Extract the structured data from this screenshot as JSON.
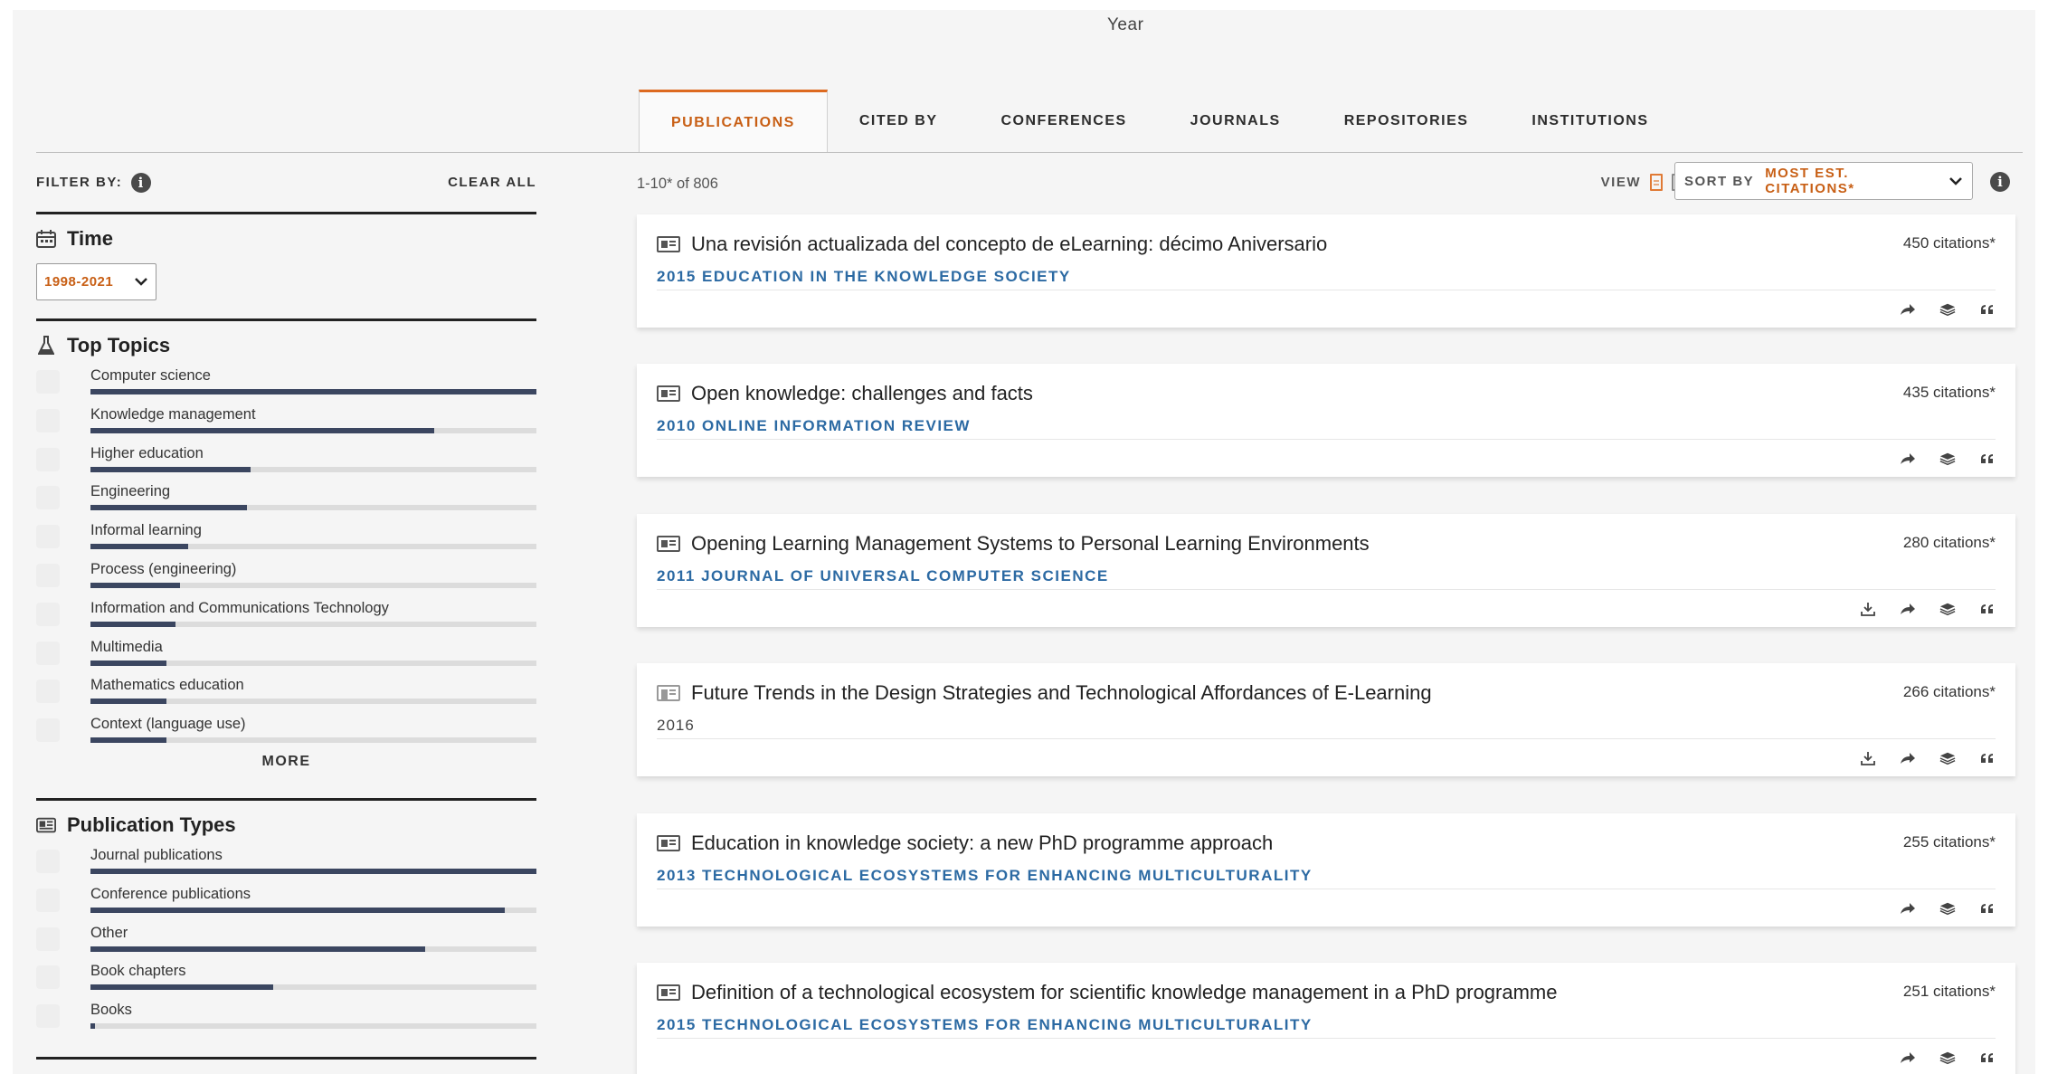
{
  "axis_title": "Year",
  "tabs": [
    {
      "label": "PUBLICATIONS",
      "active": true
    },
    {
      "label": "CITED BY",
      "active": false
    },
    {
      "label": "CONFERENCES",
      "active": false
    },
    {
      "label": "JOURNALS",
      "active": false
    },
    {
      "label": "REPOSITORIES",
      "active": false
    },
    {
      "label": "INSTITUTIONS",
      "active": false
    }
  ],
  "filters": {
    "filter_by_label": "FILTER BY:",
    "info_glyph": "i",
    "clear_all_label": "CLEAR ALL",
    "time": {
      "title": "Time",
      "icon": "calendar-icon",
      "range": "1998-2021"
    },
    "topics": {
      "title": "Top Topics",
      "icon": "flask-icon",
      "items": [
        {
          "label": "Computer science",
          "fraction": 1.0
        },
        {
          "label": "Knowledge management",
          "fraction": 0.77
        },
        {
          "label": "Higher education",
          "fraction": 0.36
        },
        {
          "label": "Engineering",
          "fraction": 0.35
        },
        {
          "label": "Informal learning",
          "fraction": 0.22
        },
        {
          "label": "Process (engineering)",
          "fraction": 0.2
        },
        {
          "label": "Information and Communications Technology",
          "fraction": 0.19
        },
        {
          "label": "Multimedia",
          "fraction": 0.17
        },
        {
          "label": "Mathematics education",
          "fraction": 0.17
        },
        {
          "label": "Context (language use)",
          "fraction": 0.17
        }
      ],
      "more_label": "MORE"
    },
    "types": {
      "title": "Publication Types",
      "icon": "newspaper-icon",
      "items": [
        {
          "label": "Journal publications",
          "fraction": 1.0
        },
        {
          "label": "Conference publications",
          "fraction": 0.93
        },
        {
          "label": "Other",
          "fraction": 0.75
        },
        {
          "label": "Book chapters",
          "fraction": 0.41
        },
        {
          "label": "Books",
          "fraction": 0.01
        }
      ]
    }
  },
  "results": {
    "count": "1-10* of 806",
    "view_label": "VIEW",
    "sort_label": "SORT BY",
    "sort_value": "MOST EST. CITATIONS*",
    "items": [
      {
        "title": "Una revisión actualizada del concepto de eLearning: décimo Aniversario",
        "venue": "2015 EDUCATION IN THE KNOWLEDGE SOCIETY",
        "citations": "450 citations*",
        "download": false,
        "venue_plain": false
      },
      {
        "title": "Open knowledge: challenges and facts",
        "venue": "2010 ONLINE INFORMATION REVIEW",
        "citations": "435 citations*",
        "download": false,
        "venue_plain": false
      },
      {
        "title": "Opening Learning Management Systems to Personal Learning Environments",
        "venue": "2011 JOURNAL OF UNIVERSAL COMPUTER SCIENCE",
        "citations": "280 citations*",
        "download": true,
        "venue_plain": false
      },
      {
        "title": "Future Trends in the Design Strategies and Technological Affordances of E-Learning",
        "venue": "2016",
        "citations": "266 citations*",
        "download": true,
        "venue_plain": true
      },
      {
        "title": "Education in knowledge society: a new PhD programme approach",
        "venue": "2013 TECHNOLOGICAL ECOSYSTEMS FOR ENHANCING MULTICULTURALITY",
        "citations": "255 citations*",
        "download": false,
        "venue_plain": false
      },
      {
        "title": "Definition of a technological ecosystem for scientific knowledge management in a PhD programme",
        "venue": "2015 TECHNOLOGICAL ECOSYSTEMS FOR ENHANCING MULTICULTURALITY",
        "citations": "251 citations*",
        "download": false,
        "venue_plain": false
      }
    ]
  },
  "colors": {
    "accent": "#dd6a20",
    "venue": "#2c6aa3",
    "bar": "#3b4660"
  }
}
